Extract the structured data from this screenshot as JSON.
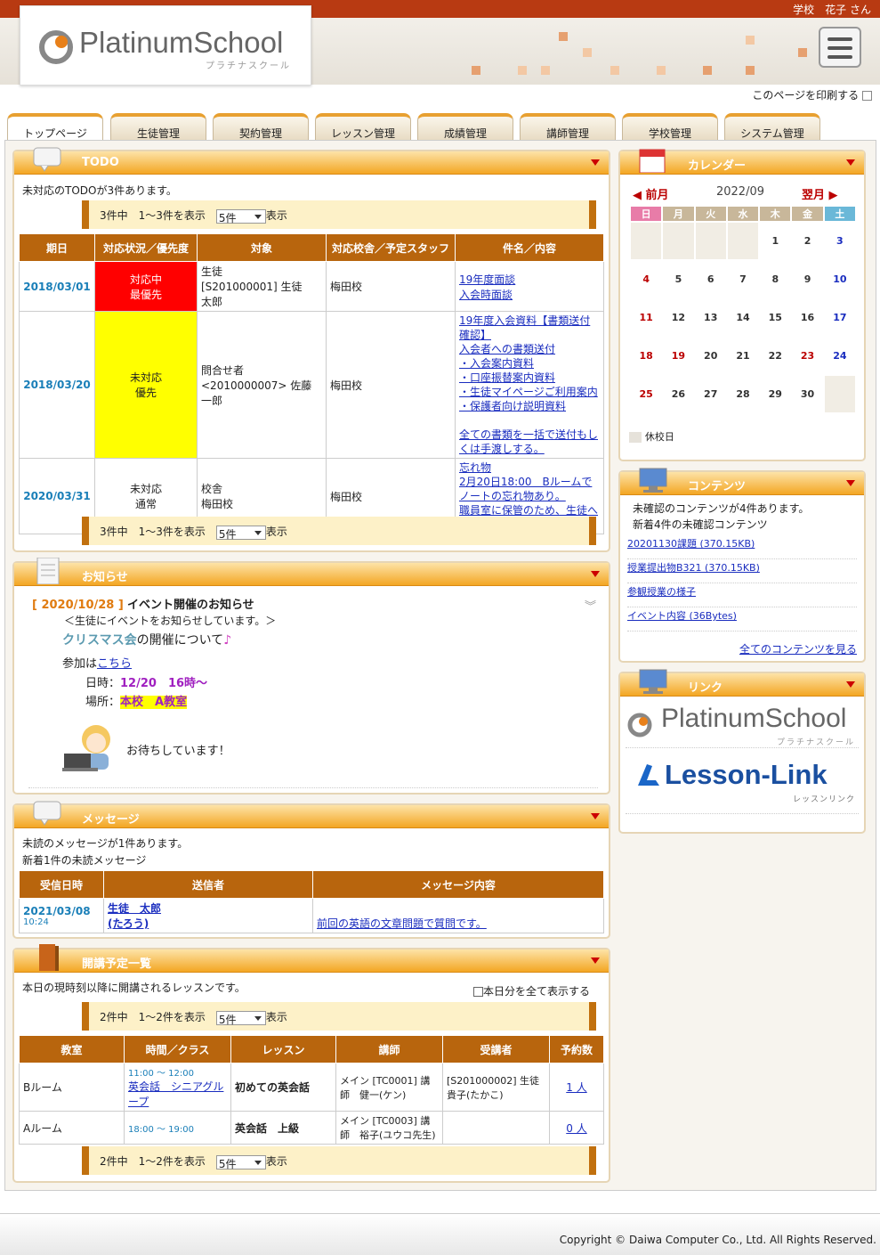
{
  "user": {
    "name": "学校　花子 さん"
  },
  "logo": {
    "text": "PlatinumSchool",
    "sub": "プラチナスクール"
  },
  "print_label": "このページを印刷する",
  "tabs": [
    "トップページ",
    "生徒管理",
    "契約管理",
    "レッスン管理",
    "成績管理",
    "講師管理",
    "学校管理",
    "システム管理"
  ],
  "todo": {
    "title": "TODO",
    "summary": "未対応のTODOが3件あります。",
    "pager": {
      "text": "3件中　1～3件を表示",
      "select": "5件",
      "suffix": "表示"
    },
    "headers": [
      "期日",
      "対応状況／優先度",
      "対象",
      "対応校舎／予定スタッフ",
      "件名／内容"
    ],
    "rows": [
      {
        "date": "2018/03/01",
        "status": "対応中",
        "priority": "最優先",
        "target1": "生徒",
        "target2": "[S201000001] 生徒　太郎",
        "school": "梅田校",
        "links": [
          "19年度面談",
          "入会時面談"
        ]
      },
      {
        "date": "2018/03/20",
        "status": "未対応",
        "priority": "優先",
        "target1": "問合せ者",
        "target2": "<2010000007> 佐藤　一郎",
        "school": "梅田校",
        "links": [
          "19年度入会資料【書類送付確認】",
          "入会者への書類送付",
          "・入会案内資料",
          "・口座振替案内資料",
          "・生徒マイページご利用案内",
          "・保護者向け説明資料",
          "",
          "全ての書類を一括で送付もしくは手渡しする。"
        ]
      },
      {
        "date": "2020/03/31",
        "status": "未対応",
        "priority": "通常",
        "target1": "校舎",
        "target2": "梅田校",
        "school": "梅田校",
        "links": [
          "忘れ物",
          "2月20日18:00　Bルームでノートの忘れ物あり。",
          "職員室に保管のため、生徒への連絡をお願いします。"
        ]
      }
    ]
  },
  "notice": {
    "title": "お知らせ",
    "date": "[ 2020/10/28 ]",
    "headline": "イベント開催のお知らせ",
    "sub": "＜生徒にイベントをお知らせしています。＞",
    "xmas": "クリスマス会",
    "xmas_rest": "の開催について",
    "note_glyph": "♪",
    "join": "参加は",
    "join_link": "こちら",
    "time_label": "日時：",
    "time_value": "12/20　16時～",
    "place_label": "場所：",
    "place_value": "本校　A教室",
    "waiting": "お待ちしています！"
  },
  "message": {
    "title": "メッセージ",
    "summary1": "未読のメッセージが1件あります。",
    "summary2": "新着1件の未読メッセージ",
    "headers": [
      "受信日時",
      "送信者",
      "メッセージ内容"
    ],
    "row": {
      "date": "2021/03/08",
      "time": "10:24",
      "sender": "生徒　太郎",
      "sender2": "(たろう)",
      "content": "前回の英語の文章問題で質問です。"
    }
  },
  "schedule": {
    "title": "開講予定一覧",
    "summary": "本日の現時刻以降に開講されるレッスンです。",
    "checkbox": "本日分を全て表示する",
    "pager": {
      "text": "2件中　1～2件を表示",
      "select": "5件",
      "suffix": "表示"
    },
    "headers": [
      "教室",
      "時間／クラス",
      "レッスン",
      "講師",
      "受講者",
      "予約数"
    ],
    "rows": [
      {
        "room": "Bルーム",
        "time": "11:00 ～ 12:00",
        "class": "英会話　シニアグループ",
        "lesson": "初めての英会話",
        "teacher": "メイン [TC0001] 講師　健一(ケン)",
        "student": "[S201000002] 生徒　貴子(たかこ)",
        "count": "1 人"
      },
      {
        "room": "Aルーム",
        "time": "18:00 ～ 19:00",
        "class": "",
        "lesson": "英会話　上級",
        "teacher": "メイン [TC0003] 講師　裕子(ユウコ先生)",
        "student": "",
        "count": "0 人"
      }
    ]
  },
  "calendar": {
    "title": "カレンダー",
    "prev": "前月",
    "next": "翌月",
    "month": "2022/09",
    "weekdays": [
      "日",
      "月",
      "火",
      "水",
      "木",
      "金",
      "土"
    ],
    "weeks": [
      [
        "",
        "",
        "",
        "",
        "1",
        "2",
        "3"
      ],
      [
        "4",
        "5",
        "6",
        "7",
        "8",
        "9",
        "10"
      ],
      [
        "11",
        "12",
        "13",
        "14",
        "15",
        "16",
        "17"
      ],
      [
        "18",
        "19",
        "20",
        "21",
        "22",
        "23",
        "24"
      ],
      [
        "25",
        "26",
        "27",
        "28",
        "29",
        "30",
        ""
      ]
    ],
    "holidays": [
      "19",
      "23"
    ],
    "legend": "休校日"
  },
  "contents": {
    "title": "コンテンツ",
    "summary1": "未確認のコンテンツが4件あります。",
    "summary2": "新着4件の未確認コンテンツ",
    "items": [
      "20201130課題 (370.15KB)",
      "授業提出物B321 (370.15KB)",
      "参観授業の様子",
      "イベント内容 (36Bytes)"
    ],
    "all": "全てのコンテンツを見る"
  },
  "links": {
    "title": "リンク",
    "logo1": "PlatinumSchool",
    "logo1_sub": "プラチナスクール",
    "logo2": "Lesson-Link",
    "logo2_sub": "レッスンリンク"
  },
  "copyright": "Copyright © Daiwa Computer Co., Ltd. All Rights Reserved.",
  "colors": {
    "brand": "#b83a12",
    "orange": "#f3a623",
    "table_head": "#b8650d",
    "urgent": "#ff0000",
    "priority": "#ffff00",
    "date": "#1a7fb8"
  }
}
